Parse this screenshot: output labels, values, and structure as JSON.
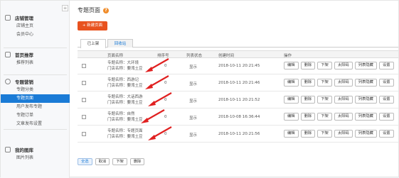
{
  "sidebar": {
    "collapse_icon": "≡",
    "groups": [
      {
        "title": "店铺管理",
        "icon": "store-icon",
        "items": [
          "店铺主页",
          "会员中心"
        ]
      },
      {
        "title": "首页推荐",
        "icon": "home-icon",
        "items": [
          "推荐列表"
        ]
      },
      {
        "title": "专题营销",
        "icon": "marketing-icon",
        "items": [
          "专题分类",
          "专题页面",
          "用户发布专题",
          "专题订单",
          "文章发布设置"
        ]
      },
      {
        "title": "我的图库",
        "icon": "gallery-icon",
        "items": [
          "图片列表"
        ]
      }
    ],
    "active_item": "专题页面"
  },
  "main": {
    "title": "专题页面",
    "help_icon": "?",
    "new_button": "+ 新建页面",
    "tabs": [
      "已上架",
      "回收站"
    ],
    "columns": [
      "页面名称",
      "排序号",
      "列表状态",
      "创建时间",
      "操作"
    ],
    "rows": [
      {
        "name": "专题名称：大环境",
        "store": "门店名称：要湾土豆",
        "sort": "0",
        "status": "显示",
        "created": "2018-10-11 20:21:45"
      },
      {
        "name": "专题名称：西游记",
        "store": "门店名称：要湾土豆",
        "sort": "0",
        "status": "显示",
        "created": "2018-10-11 20:21:46"
      },
      {
        "name": "专题名称：大话西游",
        "store": "门店名称：要湾土豆",
        "sort": "0",
        "status": "显示",
        "created": "2018-10-11 20:21:52"
      },
      {
        "name": "专题名称：自然",
        "store": "门店名称：要湾土豆",
        "sort": "0",
        "status": "显示",
        "created": "2018-10-08 16:36:44"
      },
      {
        "name": "专题名称：专题页面",
        "store": "门店名称：要湾土豆",
        "sort": "0",
        "status": "显示",
        "created": "2018-10-11 20:21:56"
      }
    ],
    "row_actions": [
      "编辑",
      "删除",
      "下架",
      "太阳码",
      "列表隐藏",
      "设置"
    ],
    "footer_actions": [
      "全选",
      "取消",
      "下架",
      "删除"
    ]
  },
  "colors": {
    "accent": "#1a7bd6",
    "primary_button": "#e8521f",
    "arrow": "#e02020"
  }
}
